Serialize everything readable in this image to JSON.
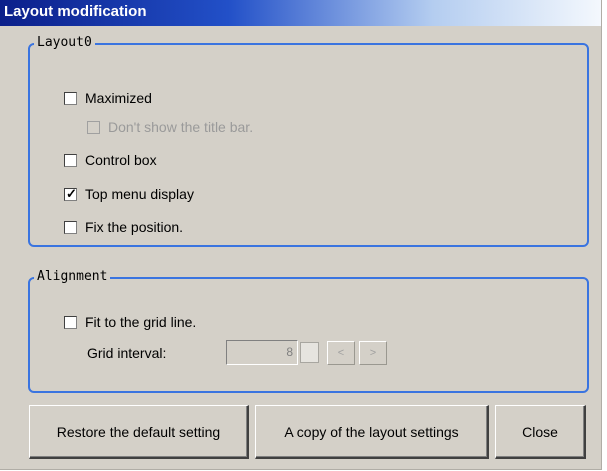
{
  "window": {
    "title": "Layout modification"
  },
  "layout_group": {
    "legend": "Layout0",
    "maximized": {
      "label": "Maximized",
      "checked": false
    },
    "hide_title_bar": {
      "label": "Don't show the title bar.",
      "checked": false,
      "disabled": true
    },
    "control_box": {
      "label": "Control box",
      "checked": false
    },
    "top_menu": {
      "label": "Top menu display",
      "checked": true
    },
    "fix_position": {
      "label": "Fix the position.",
      "checked": false
    }
  },
  "alignment_group": {
    "legend": "Alignment",
    "fit_grid": {
      "label": "Fit to the grid line.",
      "checked": false
    },
    "grid_interval": {
      "label": "Grid interval:",
      "value": "8",
      "prev": "<",
      "next": ">"
    }
  },
  "buttons": {
    "restore": "Restore the default setting",
    "copy": "A copy of the layout settings",
    "close": "Close"
  },
  "icons": {
    "checkmark": "check-icon"
  },
  "colors": {
    "group_border": "#3a74e0",
    "title_start": "#0b1f8a",
    "title_end": "#f4f8fd"
  }
}
